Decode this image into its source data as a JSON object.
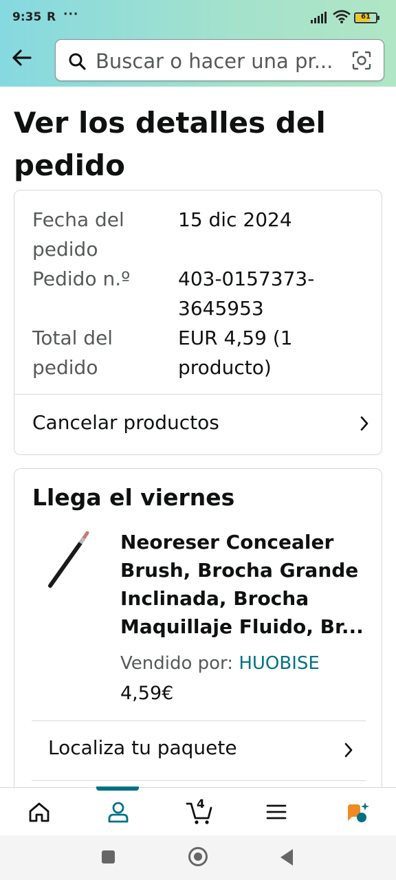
{
  "status_bar": {
    "time": "9:35",
    "carrier_icon": "R",
    "more": "···",
    "battery": "61"
  },
  "search": {
    "placeholder": "Buscar o hacer una pr..."
  },
  "page_title": "Ver los detalles del pedido",
  "order_summary": {
    "date_label": "Fecha del pedido",
    "date_value": "15 dic 2024",
    "number_label": "Pedido n.º",
    "number_value": "403-0157373-3645953",
    "total_label": "Total del pedido",
    "total_value": "EUR 4,59 (1 producto)",
    "cancel_label": "Cancelar productos"
  },
  "shipment": {
    "arrival": "Llega el viernes",
    "product_name": "Neoreser Concealer Brush, Brocha Grande Inclinada, Brocha Maquillaje Fluido, Br...",
    "seller_label": "Vendido por:",
    "seller_name": "HUOBISE",
    "price": "4,59€",
    "track_label": "Localiza tu paquete"
  },
  "bottom_nav": {
    "items": [
      "home-icon",
      "account-icon",
      "cart-icon",
      "menu-icon",
      "assistant-icon"
    ],
    "cart_count": "4",
    "active": "account-icon"
  },
  "colors": {
    "accent": "#007185",
    "header_gradient_start": "#86d9e0",
    "header_gradient_end": "#b0e6c4",
    "assistant": "#f08a24"
  }
}
